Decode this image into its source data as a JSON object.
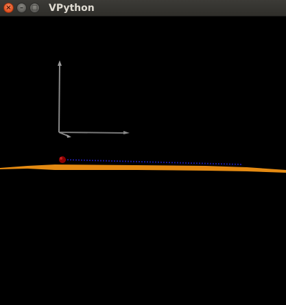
{
  "window": {
    "title": "VPython",
    "buttons": {
      "close_icon": "close-icon",
      "minimize_icon": "minimize-icon",
      "maximize_icon": "maximize-icon"
    }
  },
  "scene": {
    "background": "#000000",
    "axes_color": "#8a8a8a",
    "floor_color": "#e48a12",
    "ball_color": "#8b0000",
    "trail_color": "#1a1aa0"
  }
}
